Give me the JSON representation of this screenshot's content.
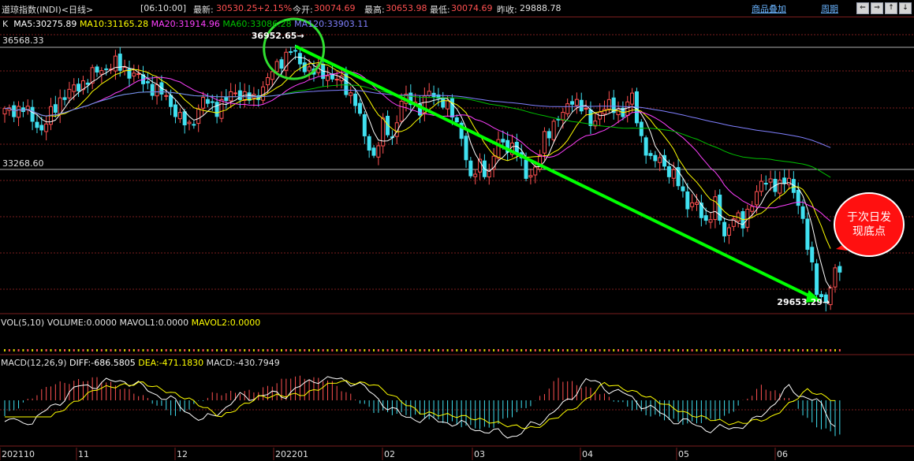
{
  "header": {
    "title": "道琼指数(INDI)<日线>",
    "time": "[06:10:00]",
    "latest_label": "最新:",
    "latest_value": "30530.25",
    "change": "+2.15%",
    "open_label": "今开:",
    "open_value": "30074.69",
    "high_label": "最高:",
    "high_value": "30653.98",
    "low_label": "最低:",
    "low_value": "30074.69",
    "prev_label": "昨收:",
    "prev_value": "29888.78",
    "overlay_button": "商品叠加",
    "period_button": "周期"
  },
  "ma_legend": {
    "k": "K",
    "ma5": "MA5:30275.89",
    "ma10": "MA10:31165.28",
    "ma20": "MA20:31914.96",
    "ma60": "MA60:33086.28",
    "ma120": "MA120:33903.11"
  },
  "vol_legend": {
    "vol": "VOL(5,10)",
    "volume": "VOLUME:0.0000",
    "mavol1": "MAVOL1:0.0000",
    "mavol2": "MAVOL2:0.0000"
  },
  "macd_legend": {
    "macd": "MACD(12,26,9)",
    "diff": "DIFF:-686.5805",
    "dea": "DEA:-471.1830",
    "value": "MACD:-430.7949"
  },
  "colors": {
    "up": "#ff5050",
    "down": "#40e0f0",
    "ma5": "#ffffff",
    "ma10": "#ffff00",
    "ma20": "#ff40ff",
    "ma60": "#00c000",
    "ma120": "#8080ff",
    "grid": "#7a1e1e",
    "trend": "#00ff00"
  },
  "annotations": {
    "callout": "于次日发现底点",
    "high_marker": "36952.65",
    "low_marker": "29653.29"
  },
  "chart_data": {
    "type": "candlestick",
    "y_ticks": [
      "36568.33",
      "33268.60"
    ],
    "ylim": [
      29400,
      37300
    ],
    "x_labels": [
      "202110",
      "11",
      "12",
      "202201",
      "02",
      "03",
      "04",
      "05",
      "06"
    ],
    "grid": true,
    "high_marker": {
      "index": 62,
      "value": 36952.65
    },
    "low_marker": {
      "index": 178,
      "value": 29653.29
    },
    "trend_line": [
      {
        "index": 63,
        "value": 36900
      },
      {
        "index": 177,
        "value": 29700
      }
    ],
    "close_anchors": [
      [
        0,
        34900
      ],
      [
        4,
        35000
      ],
      [
        8,
        34400
      ],
      [
        12,
        35250
      ],
      [
        16,
        35600
      ],
      [
        20,
        36000
      ],
      [
        24,
        36200
      ],
      [
        28,
        35900
      ],
      [
        32,
        35550
      ],
      [
        35,
        35300
      ],
      [
        38,
        34700
      ],
      [
        40,
        34500
      ],
      [
        43,
        35200
      ],
      [
        46,
        35000
      ],
      [
        50,
        35450
      ],
      [
        54,
        35200
      ],
      [
        57,
        35800
      ],
      [
        60,
        36300
      ],
      [
        62,
        36600
      ],
      [
        64,
        36200
      ],
      [
        67,
        36000
      ],
      [
        70,
        35900
      ],
      [
        73,
        35700
      ],
      [
        76,
        35200
      ],
      [
        78,
        34200
      ],
      [
        80,
        33700
      ],
      [
        82,
        34500
      ],
      [
        84,
        34200
      ],
      [
        86,
        35200
      ],
      [
        88,
        35200
      ],
      [
        90,
        35000
      ],
      [
        92,
        35400
      ],
      [
        95,
        35200
      ],
      [
        97,
        34800
      ],
      [
        99,
        34300
      ],
      [
        101,
        33000
      ],
      [
        103,
        33500
      ],
      [
        105,
        33200
      ],
      [
        107,
        34100
      ],
      [
        109,
        34000
      ],
      [
        111,
        33800
      ],
      [
        113,
        33200
      ],
      [
        115,
        33300
      ],
      [
        117,
        34200
      ],
      [
        119,
        34600
      ],
      [
        121,
        34800
      ],
      [
        123,
        35300
      ],
      [
        125,
        35000
      ],
      [
        127,
        34600
      ],
      [
        130,
        35000
      ],
      [
        132,
        35050
      ],
      [
        134,
        34850
      ],
      [
        136,
        35300
      ],
      [
        138,
        34200
      ],
      [
        140,
        33500
      ],
      [
        142,
        33700
      ],
      [
        144,
        33200
      ],
      [
        146,
        33000
      ],
      [
        148,
        32400
      ],
      [
        150,
        32300
      ],
      [
        152,
        31900
      ],
      [
        154,
        32400
      ],
      [
        156,
        31500
      ],
      [
        158,
        32100
      ],
      [
        160,
        31800
      ],
      [
        162,
        32500
      ],
      [
        164,
        32900
      ],
      [
        166,
        33000
      ],
      [
        168,
        32900
      ],
      [
        170,
        33000
      ],
      [
        172,
        32500
      ],
      [
        174,
        31200
      ],
      [
        176,
        30100
      ],
      [
        178,
        29650
      ],
      [
        180,
        30530
      ]
    ],
    "macd_anchors": [
      [
        0,
        -200
      ],
      [
        10,
        200
      ],
      [
        20,
        280
      ],
      [
        30,
        50
      ],
      [
        37,
        -200
      ],
      [
        45,
        80
      ],
      [
        55,
        120
      ],
      [
        62,
        300
      ],
      [
        70,
        260
      ],
      [
        80,
        -140
      ],
      [
        90,
        -200
      ],
      [
        100,
        -330
      ],
      [
        105,
        -360
      ],
      [
        115,
        -20
      ],
      [
        120,
        280
      ],
      [
        128,
        120
      ],
      [
        138,
        -160
      ],
      [
        148,
        -300
      ],
      [
        156,
        -220
      ],
      [
        164,
        180
      ],
      [
        170,
        30
      ],
      [
        175,
        -300
      ],
      [
        180,
        -430
      ]
    ]
  }
}
